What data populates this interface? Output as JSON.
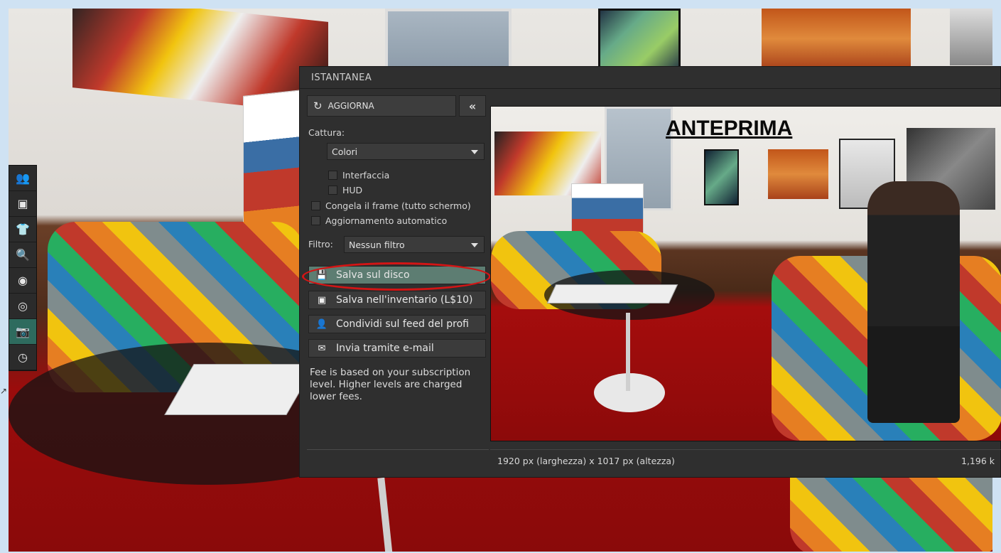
{
  "panel": {
    "title": "ISTANTANEA",
    "refresh_label": "AGGIORNA",
    "collapse_label": "«",
    "capture_label": "Cattura:",
    "capture_value": "Colori",
    "checks": {
      "interface": "Interfaccia",
      "hud": "HUD",
      "freeze": "Congela il frame (tutto schermo)",
      "auto_update": "Aggiornamento automatico"
    },
    "filter_label": "Filtro:",
    "filter_value": "Nessun filtro",
    "actions": {
      "save_disk": "Salva sul disco",
      "save_inventory": "Salva nell'inventario (L$10)",
      "share_feed": "Condividi sul feed del profi",
      "send_email": "Invia tramite e-mail"
    },
    "fee_note": "Fee is based on your subscription level. Higher levels are charged lower fees.",
    "preview_label": "ANTEPRIMA",
    "dimensions": "1920 px (larghezza) x 1017 px (altezza)",
    "size": "1,196 k"
  },
  "toolbar": {
    "icons": [
      "people-icon",
      "inventory-icon",
      "appearance-icon",
      "search-icon",
      "map-icon",
      "voice-icon",
      "snapshot-icon",
      "performance-icon"
    ]
  }
}
